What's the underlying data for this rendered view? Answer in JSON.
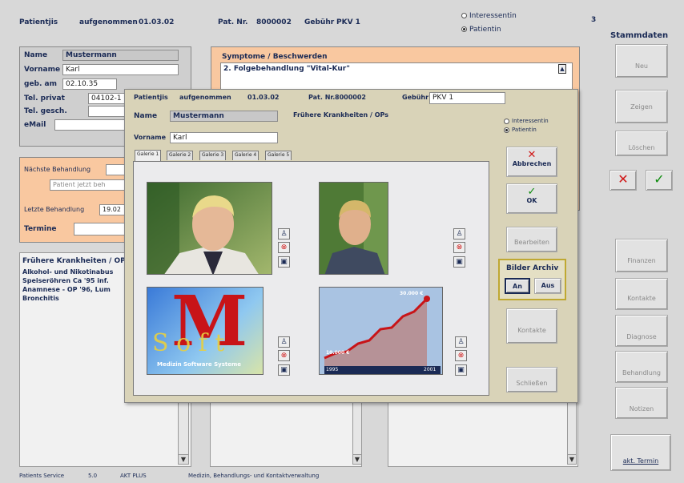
{
  "header": {
    "status_label": "Patientjis",
    "status_value": "aufgenommen",
    "date": "01.03.02",
    "pat_nr_label": "Pat. Nr.",
    "pat_nr_value": "8000002",
    "gebuehr_label": "Gebühr",
    "gebuehr_value": "PKV 1",
    "radio_interessent": "Interessentin",
    "radio_patient": "Patientin",
    "page_indicator": "3"
  },
  "stammdaten": {
    "title": "Stammdaten",
    "neu": "Neu",
    "zeigen": "Zeigen",
    "loeschen": "Löschen",
    "cancel": "✕",
    "ok": "✓",
    "finanzen": "Finanzen",
    "kontakte": "Kontakte",
    "diagnose": "Diagnose",
    "behandlung": "Behandlung",
    "notizen": "Notizen",
    "akt_termin": "akt. Termin"
  },
  "patient": {
    "name_label": "Name",
    "name_value": "Mustermann",
    "vorname_label": "Vorname",
    "vorname_value": "Karl",
    "geb_label": "geb. am",
    "geb_value": "02.10.35",
    "tel_privat_label": "Tel. privat",
    "tel_privat_value": "04102-1",
    "tel_gesch_label": "Tel. gesch.",
    "email_label": "eMail"
  },
  "behandlung": {
    "naechste_label": "Nächste Behandlung",
    "jetzt_placeholder": "Patient jetzt beh",
    "letzte_label": "Letzte Behandlung",
    "letzte_value": "19.02",
    "termine_label": "Termine"
  },
  "fruehere_bg": {
    "title": "Frühere Krankheiten / OP",
    "text": "Alkohol- und Nikotinabus\nSpeiseröhren Ca '95 inf.\nAnamnese - OP '96, Lum\nBronchitis"
  },
  "symptome": {
    "title": "Symptome / Beschwerden",
    "text": "2. Folgebehandlung \"Vital-Kur\""
  },
  "dialog": {
    "status_label": "Patientjis",
    "status_value": "aufgenommen",
    "date": "01.03.02",
    "pat_nr_label": "Pat. Nr.",
    "pat_nr_value": "8000002",
    "gebuehr_label": "Gebühr",
    "gebuehr_value": "PKV 1",
    "name_label": "Name",
    "name_value": "Mustermann",
    "vorname_label": "Vorname",
    "vorname_value": "Karl",
    "fruehere_label": "Frühere Krankheiten / OPs",
    "radio_interessent": "Interessentin",
    "radio_patient": "Patientin",
    "tabs": [
      "Galerie 1",
      "Galerie 2",
      "Galerie 3",
      "Galerie 4",
      "Galerie 5"
    ],
    "abbrechen": "Abbrechen",
    "ok": "OK",
    "bearbeiten": "Bearbeiten",
    "bilder_archiv": "Bilder Archiv",
    "an": "An",
    "aus": "Aus",
    "kontakte": "Kontakte",
    "schliessen": "Schließen",
    "logo_text": "Medizin Software Systeme",
    "chart_top_label": "30.000 €",
    "chart_left_label": "10.000 €",
    "chart_x_start": "1995",
    "chart_x_end": "2001"
  },
  "statusbar": {
    "item1": "Patients Service",
    "item2": "5.0",
    "item3": "AKT PLUS",
    "item4": "Medizin, Behandlungs- und Kontaktverwaltung"
  },
  "colors": {
    "peach": "#f9c8a0",
    "panel_grey": "#cfcfcf",
    "dialog_bg": "#d9d3b8",
    "navy": "#1a2a55",
    "cancel_red": "#d01818",
    "ok_green": "#0a8a0a"
  }
}
